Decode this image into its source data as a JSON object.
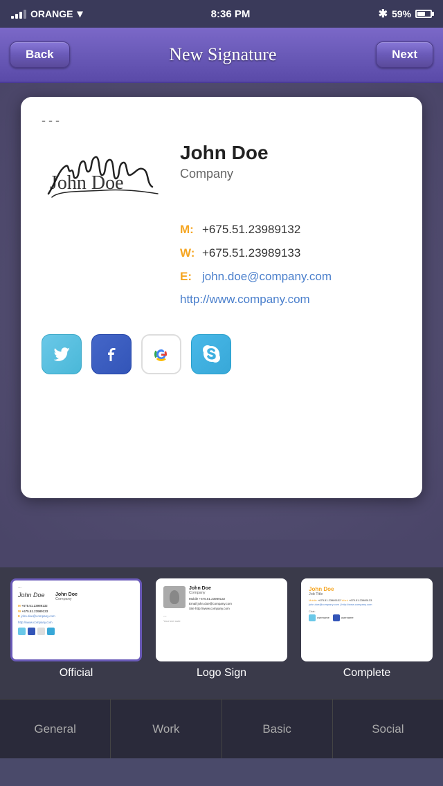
{
  "statusBar": {
    "carrier": "ORANGE",
    "time": "8:36 PM",
    "battery": "59%"
  },
  "navBar": {
    "backLabel": "Back",
    "title": "New Signature",
    "nextLabel": "Next"
  },
  "signatureCard": {
    "dashes": "---",
    "personName": "John Doe",
    "company": "Company",
    "mobile_label": "M:",
    "mobile": "+675.51.23989132",
    "work_label": "W:",
    "work": "+675.51.23989133",
    "email_label": "E:",
    "email": "john.doe@company.com",
    "website": "http://www.company.com"
  },
  "templates": [
    {
      "label": "Official",
      "active": true
    },
    {
      "label": "Logo Sign",
      "active": false
    },
    {
      "label": "Complete",
      "active": false
    }
  ],
  "tabs": [
    {
      "label": "General",
      "active": false
    },
    {
      "label": "Work",
      "active": false
    },
    {
      "label": "Basic",
      "active": false
    },
    {
      "label": "Social",
      "active": false
    }
  ],
  "socialIcons": [
    {
      "name": "Twitter"
    },
    {
      "name": "Facebook"
    },
    {
      "name": "Google+"
    },
    {
      "name": "Skype"
    }
  ]
}
